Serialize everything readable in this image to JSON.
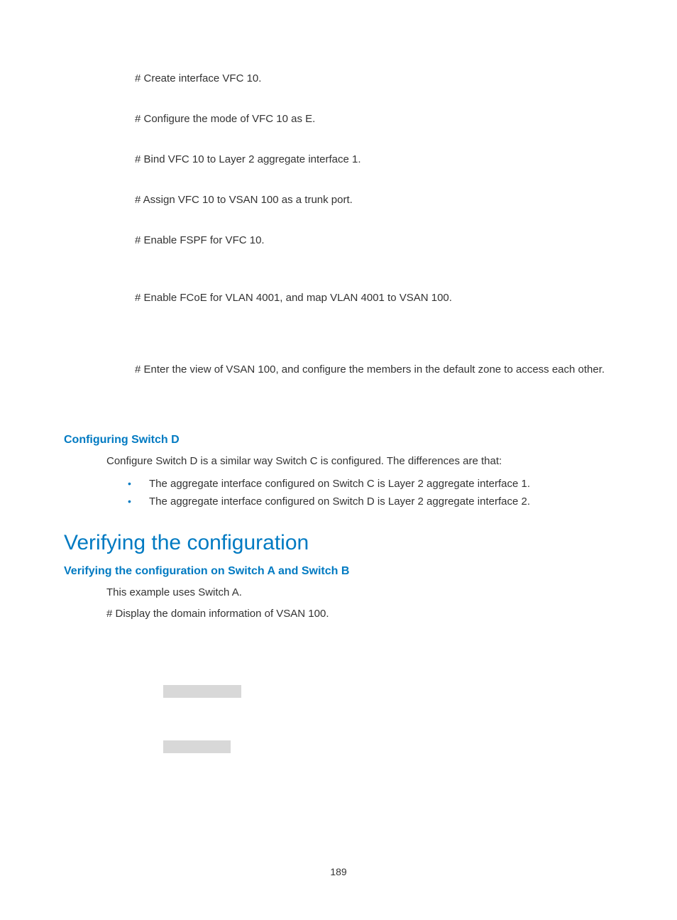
{
  "steps": {
    "s1": "# Create interface VFC 10.",
    "s2": "# Configure the mode of VFC 10 as E.",
    "s3": "# Bind VFC 10 to Layer 2 aggregate interface 1.",
    "s4": "# Assign VFC 10 to VSAN 100 as a trunk port.",
    "s5": "# Enable FSPF for VFC 10.",
    "s6": "# Enable FCoE for VLAN 4001, and map VLAN 4001 to VSAN 100.",
    "s7": "# Enter the view of VSAN 100, and configure the members in the default zone to access each other."
  },
  "switchD": {
    "heading": "Configuring Switch D",
    "intro": "Configure Switch D is a similar way Switch C is configured. The differences are that:",
    "b1": "The aggregate interface configured on Switch C is Layer 2 aggregate interface 1.",
    "b2": "The aggregate interface configured on Switch D is Layer 2 aggregate interface 2."
  },
  "verify": {
    "heading": "Verifying the configuration",
    "sub": "Verifying the configuration on Switch A and Switch B",
    "l1": "This example uses Switch A.",
    "l2": "# Display the domain information of VSAN 100."
  },
  "page": "189"
}
